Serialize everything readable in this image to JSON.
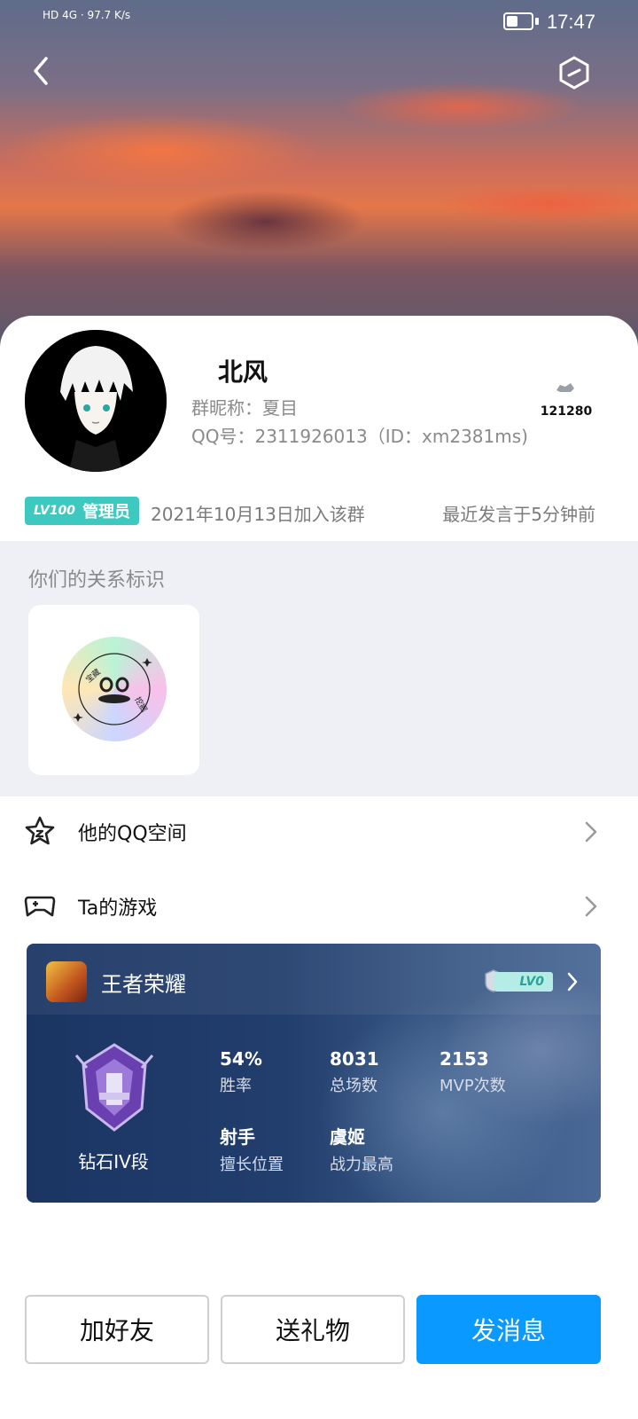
{
  "status_bar": {
    "network": "HD 4G",
    "speed": "97.7",
    "speed_unit": "K/s",
    "time": "17:47"
  },
  "profile": {
    "name": "北风",
    "nickname": "群昵称：夏目",
    "qq": "QQ号：2311926013（ID：xm2381ms)",
    "charm_value": "121280"
  },
  "membership": {
    "level": "LV100",
    "role": "管理员",
    "joined": "2021年10月13日加入该群",
    "last_speak": "最近发言于5分钟前"
  },
  "relation": {
    "title": "你们的关系标识",
    "badge_text": "宝藏值得挖掘"
  },
  "menu": [
    {
      "label": "他的QQ空间",
      "icon": "star-icon"
    },
    {
      "label": "Ta的游戏",
      "icon": "gamepad-icon"
    }
  ],
  "game": {
    "title": "王者荣耀",
    "level_badge": "LV0",
    "rank": "钻石IV段",
    "stats": [
      {
        "value": "54%",
        "label": "胜率"
      },
      {
        "value": "8031",
        "label": "总场数"
      },
      {
        "value": "2153",
        "label": "MVP次数"
      },
      {
        "value": "射手",
        "label": "擅长位置"
      },
      {
        "value": "虞姬",
        "label": "战力最高"
      }
    ]
  },
  "actions": {
    "add_friend": "加好友",
    "send_gift": "送礼物",
    "send_message": "发消息"
  },
  "colors": {
    "accent": "#0999ff",
    "badge": "#3ec9c0"
  }
}
